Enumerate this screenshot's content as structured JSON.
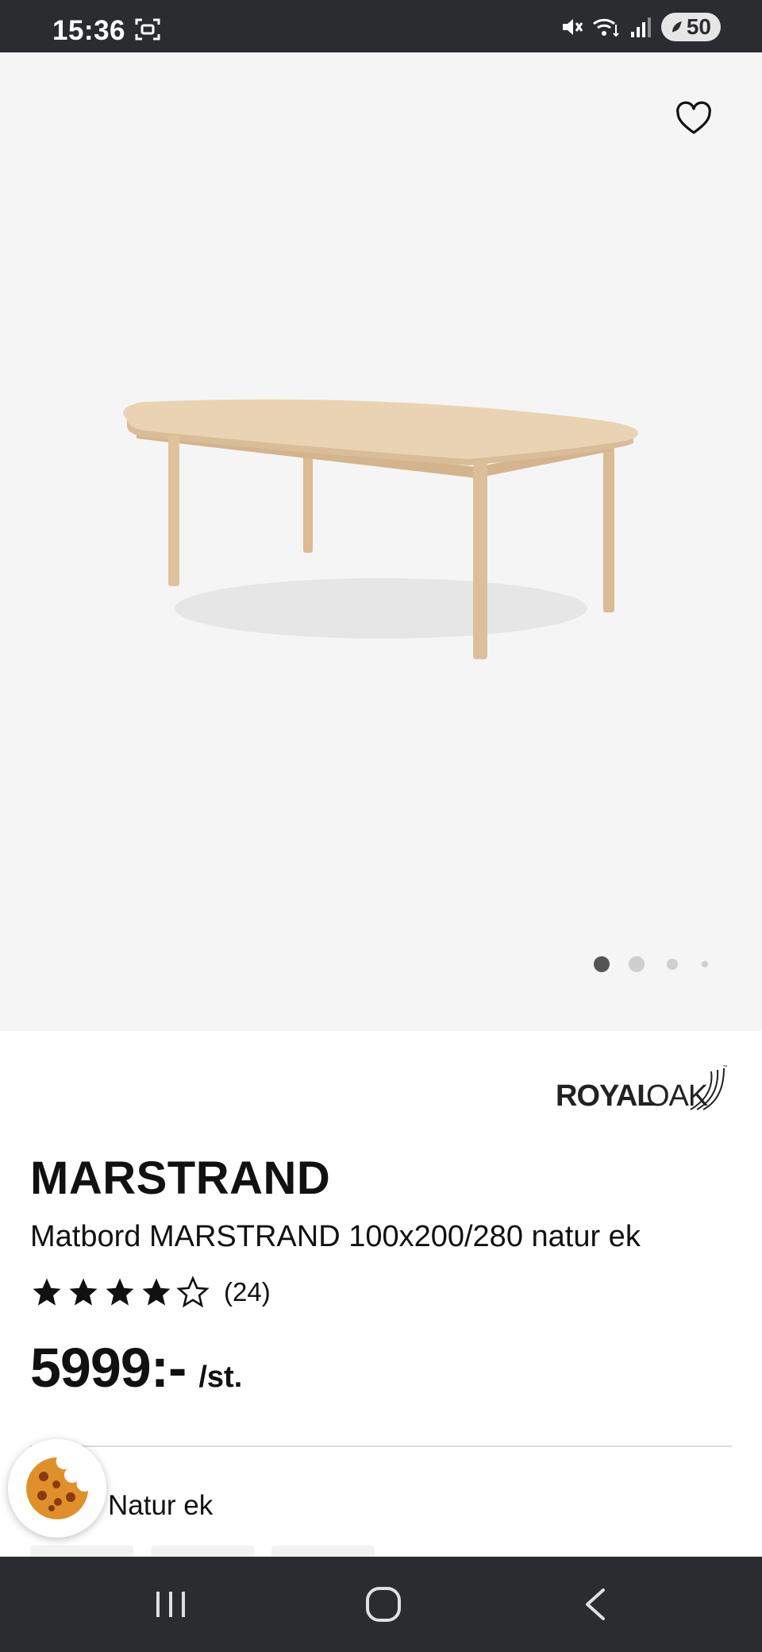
{
  "status_bar": {
    "time": "15:36",
    "battery": "50",
    "icons": [
      "screenshot-icon",
      "mute-icon",
      "wifi-icon",
      "signal-icon",
      "battery-icon"
    ]
  },
  "gallery": {
    "image_alt": "Matbord MARSTRAND natur ek",
    "dots_count": 4,
    "active_dot": 0
  },
  "product": {
    "brand_royal": "ROYAL",
    "brand_oak": "OAK",
    "brand_tm": "™",
    "title": "MARSTRAND",
    "subtitle": "Matbord MARSTRAND 100x200/280 natur ek",
    "rating_value": 4,
    "rating_max": 5,
    "rating_count": "(24)",
    "price": "5999:-",
    "price_unit": "/st.",
    "variant_label": "Natur ek"
  },
  "colors": {
    "status_bg": "#2b2c30",
    "gallery_bg": "#f5f5f5",
    "wood_light": "#e8cfae",
    "wood_dark": "#d4b48d",
    "cookie": "#e0902a"
  }
}
